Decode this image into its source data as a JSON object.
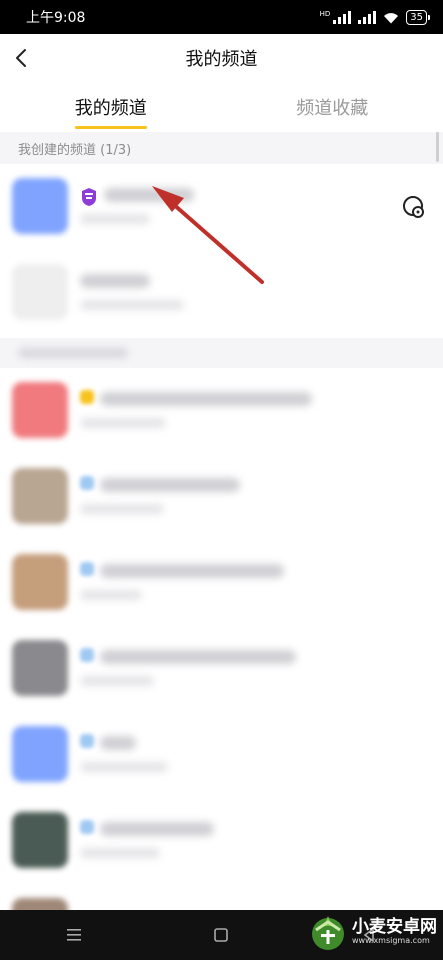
{
  "status_bar": {
    "time": "上午9:08",
    "battery": "35",
    "network": "HD"
  },
  "header": {
    "title": "我的频道"
  },
  "tabs": [
    {
      "label": "我的频道",
      "active": true
    },
    {
      "label": "频道收藏",
      "active": false
    }
  ],
  "created_section": {
    "title": "我创建的频道 (1/3)"
  },
  "colors": {
    "accent": "#f7c21b",
    "badge": "#8e3cd8",
    "arrow": "#c0302a"
  },
  "icons": {
    "back": "chevron-left-icon",
    "badge": "shield-badge-icon",
    "settings": "gear-icon",
    "menu": "menu-icon",
    "home": "square-icon",
    "back_nav": "triangle-back-icon"
  },
  "watermark": {
    "text": "小麦安卓网",
    "url": "www.xmsigma.com"
  }
}
